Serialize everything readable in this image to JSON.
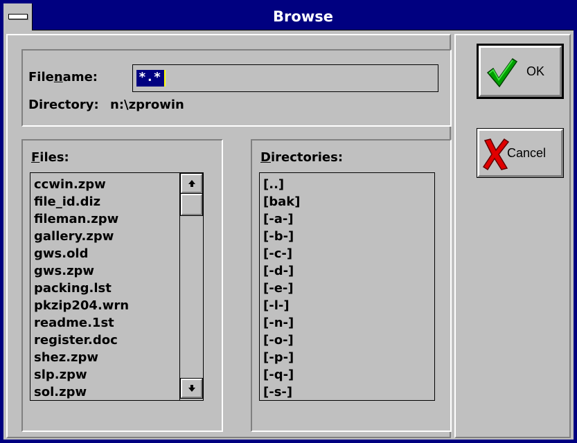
{
  "window": {
    "title": "Browse"
  },
  "icons": {
    "system_menu": "system-menu-icon",
    "ok": "green-checkmark-icon",
    "cancel": "red-x-icon",
    "scroll_up": "up-arrow-icon",
    "scroll_down": "down-arrow-icon"
  },
  "fields": {
    "filename": {
      "label_pre": "File",
      "label_hotkey": "n",
      "label_post": "ame:",
      "value": "*.*"
    },
    "directory": {
      "label": "Directory:",
      "value": "n:\\zprowin"
    }
  },
  "files": {
    "label_hotkey": "F",
    "label_rest": "iles:",
    "items": [
      "ccwin.zpw",
      "file_id.diz",
      "fileman.zpw",
      "gallery.zpw",
      "gws.old",
      "gws.zpw",
      "packing.lst",
      "pkzip204.wrn",
      "readme.1st",
      "register.doc",
      "shez.zpw",
      "slp.zpw",
      "sol.zpw"
    ]
  },
  "directories": {
    "label_hotkey": "D",
    "label_rest": "irectories:",
    "items": [
      "[..]",
      "[bak]",
      "[-a-]",
      "[-b-]",
      "[-c-]",
      "[-d-]",
      "[-e-]",
      "[-l-]",
      "[-n-]",
      "[-o-]",
      "[-p-]",
      "[-q-]",
      "[-s-]"
    ]
  },
  "buttons": {
    "ok": "OK",
    "cancel": "Cancel"
  },
  "colors": {
    "titlebar": "#000080",
    "face": "#c0c0c0",
    "selection": "#000080",
    "check": "#00a000",
    "x": "#e00000"
  }
}
